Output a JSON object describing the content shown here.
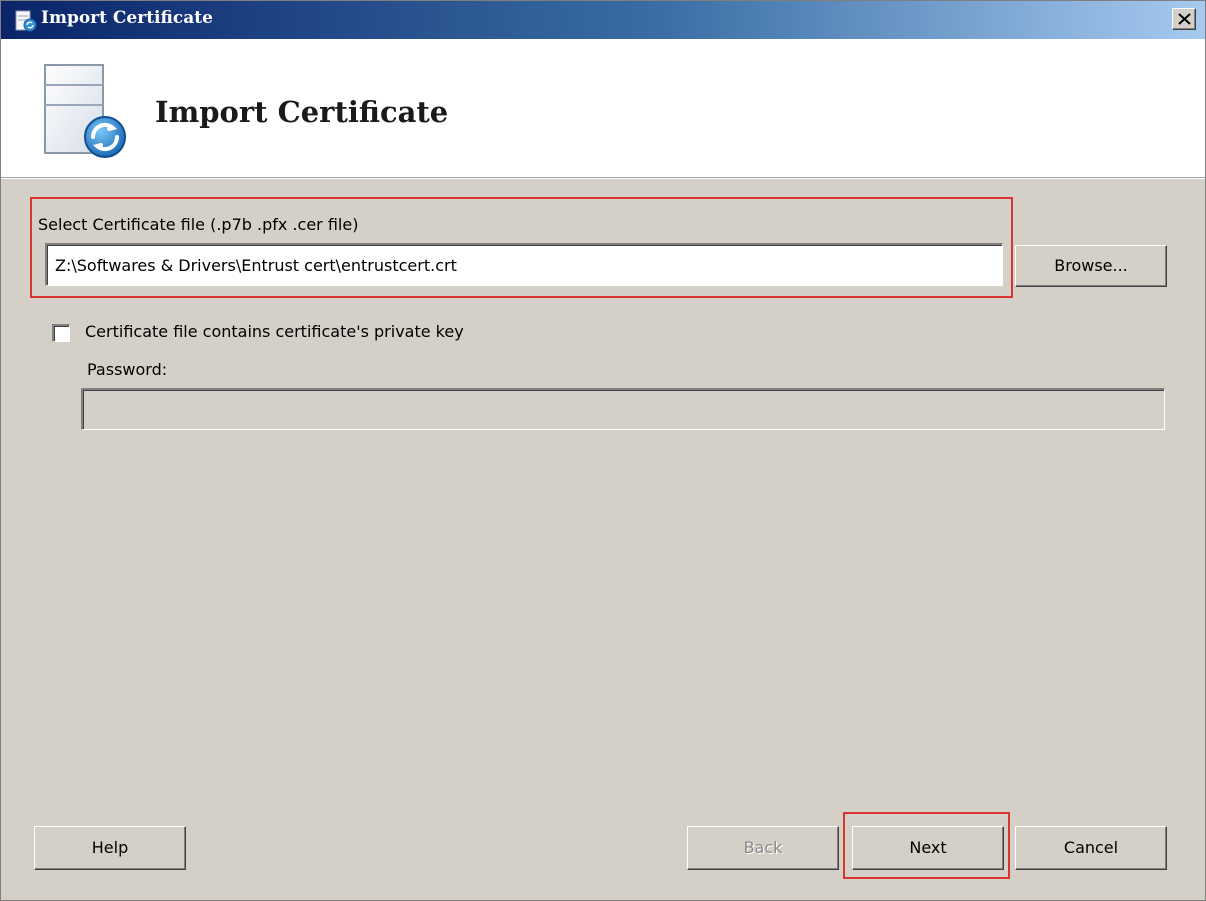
{
  "window": {
    "title": "Import Certificate",
    "close_label": "X"
  },
  "header": {
    "title": "Import Certificate",
    "icon": "certificate-import-icon"
  },
  "cert_file": {
    "label": "Select Certificate file (.p7b .pfx .cer file)",
    "value": "Z:\\Softwares & Drivers\\Entrust cert\\entrustcert.crt",
    "browse_label": "Browse..."
  },
  "private_key": {
    "checkbox_label": "Certificate file contains certificate's private key",
    "checked": false,
    "password_label": "Password:",
    "password_value": ""
  },
  "buttons": {
    "help": "Help",
    "back": "Back",
    "next": "Next",
    "cancel": "Cancel"
  },
  "colors": {
    "highlight": "#d9342f",
    "dialog_bg": "#d4d0c8",
    "titlebar_start": "#0a246a",
    "titlebar_end": "#a6caf0"
  }
}
